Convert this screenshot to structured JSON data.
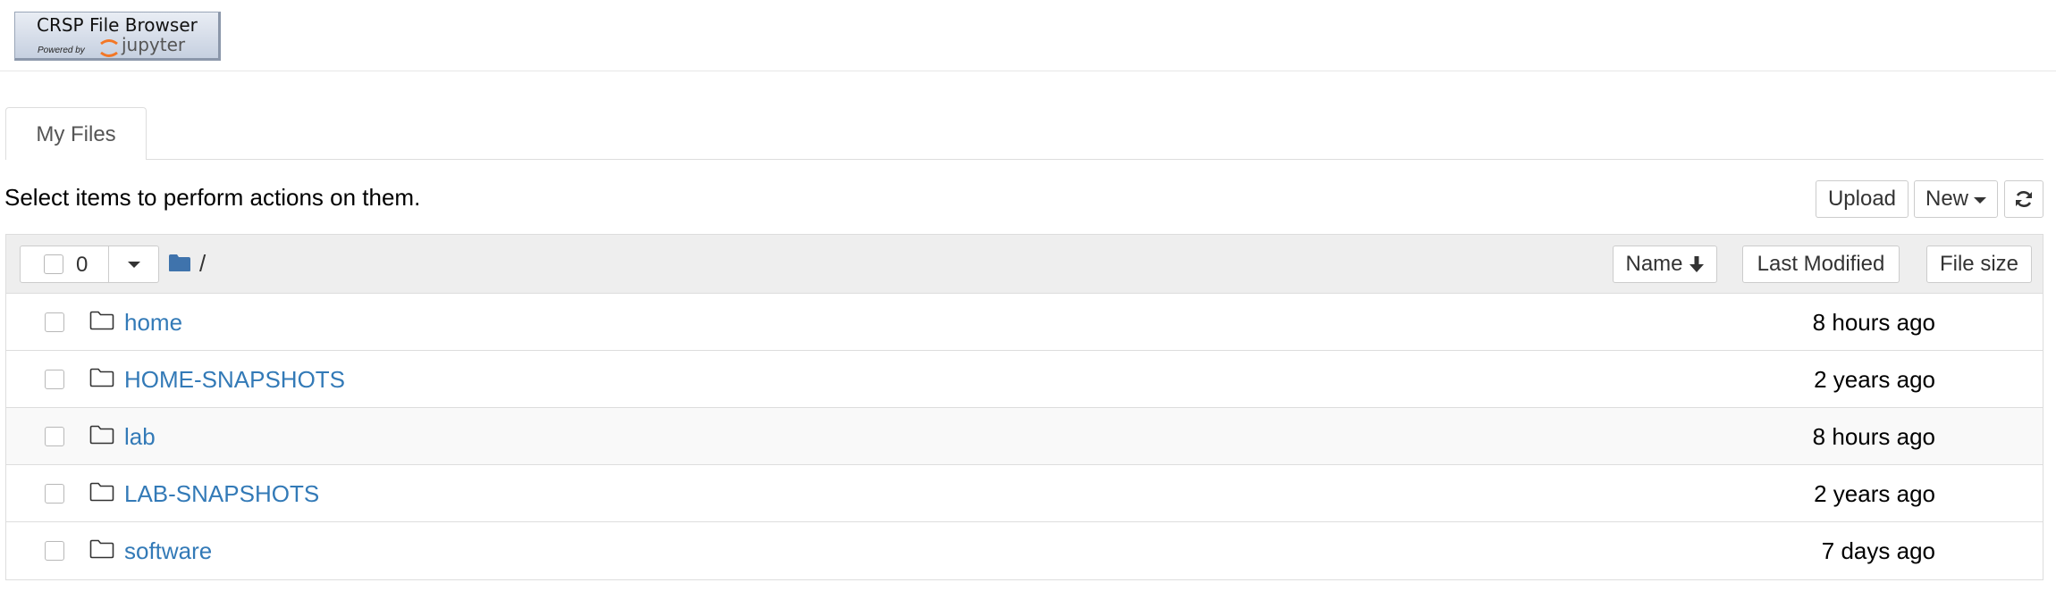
{
  "header": {
    "logo_title": "CRSP File Browser",
    "logo_powered": "Powered by",
    "logo_jupyter": "jupyter"
  },
  "tabs": [
    {
      "label": "My Files",
      "active": true
    }
  ],
  "instructions": "Select items to perform actions on them.",
  "toolbar": {
    "upload": "Upload",
    "new": "New"
  },
  "list_header": {
    "selected_count": "0",
    "path": "/",
    "sort_name": "Name",
    "sort_modified": "Last Modified",
    "sort_size": "File size"
  },
  "items": [
    {
      "name": "home",
      "modified": "8 hours ago",
      "icon": "folder-icon"
    },
    {
      "name": "HOME-SNAPSHOTS",
      "modified": "2 years ago",
      "icon": "folder-icon"
    },
    {
      "name": "lab",
      "modified": "8 hours ago",
      "icon": "folder-icon"
    },
    {
      "name": "LAB-SNAPSHOTS",
      "modified": "2 years ago",
      "icon": "folder-icon"
    },
    {
      "name": "software",
      "modified": "7 days ago",
      "icon": "folder-icon"
    }
  ],
  "colors": {
    "link": "#337ab7",
    "folder": "#3f73ac",
    "header_bg": "#eeeeee"
  }
}
